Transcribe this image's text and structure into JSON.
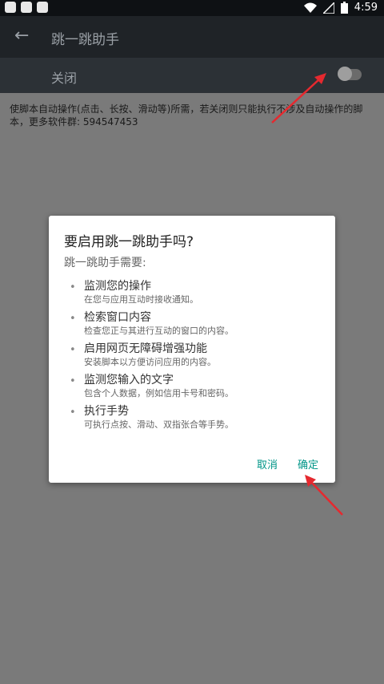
{
  "status": {
    "time": "4:59",
    "icons": [
      "app-icon",
      "white-square-icon",
      "a-icon",
      "wifi-icon",
      "signal-icon",
      "battery-icon"
    ]
  },
  "appbar": {
    "title": "跳一跳助手",
    "back_icon": "arrow-back-icon"
  },
  "toggle": {
    "label": "关闭",
    "on": false
  },
  "description": "使脚本自动操作(点击、长按、滑动等)所需，若关闭则只能执行不涉及自动操作的脚本，更多软件群: 594547453",
  "dialog": {
    "title": "要启用跳一跳助手吗?",
    "subtitle": "跳一跳助手需要:",
    "permissions": [
      {
        "title": "监测您的操作",
        "desc": "在您与应用互动时接收通知。"
      },
      {
        "title": "检索窗口内容",
        "desc": "检查您正与其进行互动的窗口的内容。"
      },
      {
        "title": "启用网页无障碍增强功能",
        "desc": "安装脚本以方便访问应用的内容。"
      },
      {
        "title": "监测您输入的文字",
        "desc": "包含个人数据，例如信用卡号和密码。"
      },
      {
        "title": "执行手势",
        "desc": "可执行点按、滑动、双指张合等手势。"
      }
    ],
    "cancel_label": "取消",
    "ok_label": "确定"
  },
  "colors": {
    "accent": "#009688",
    "annotation": "#e5292f",
    "scrim": "#7a7a7a"
  }
}
